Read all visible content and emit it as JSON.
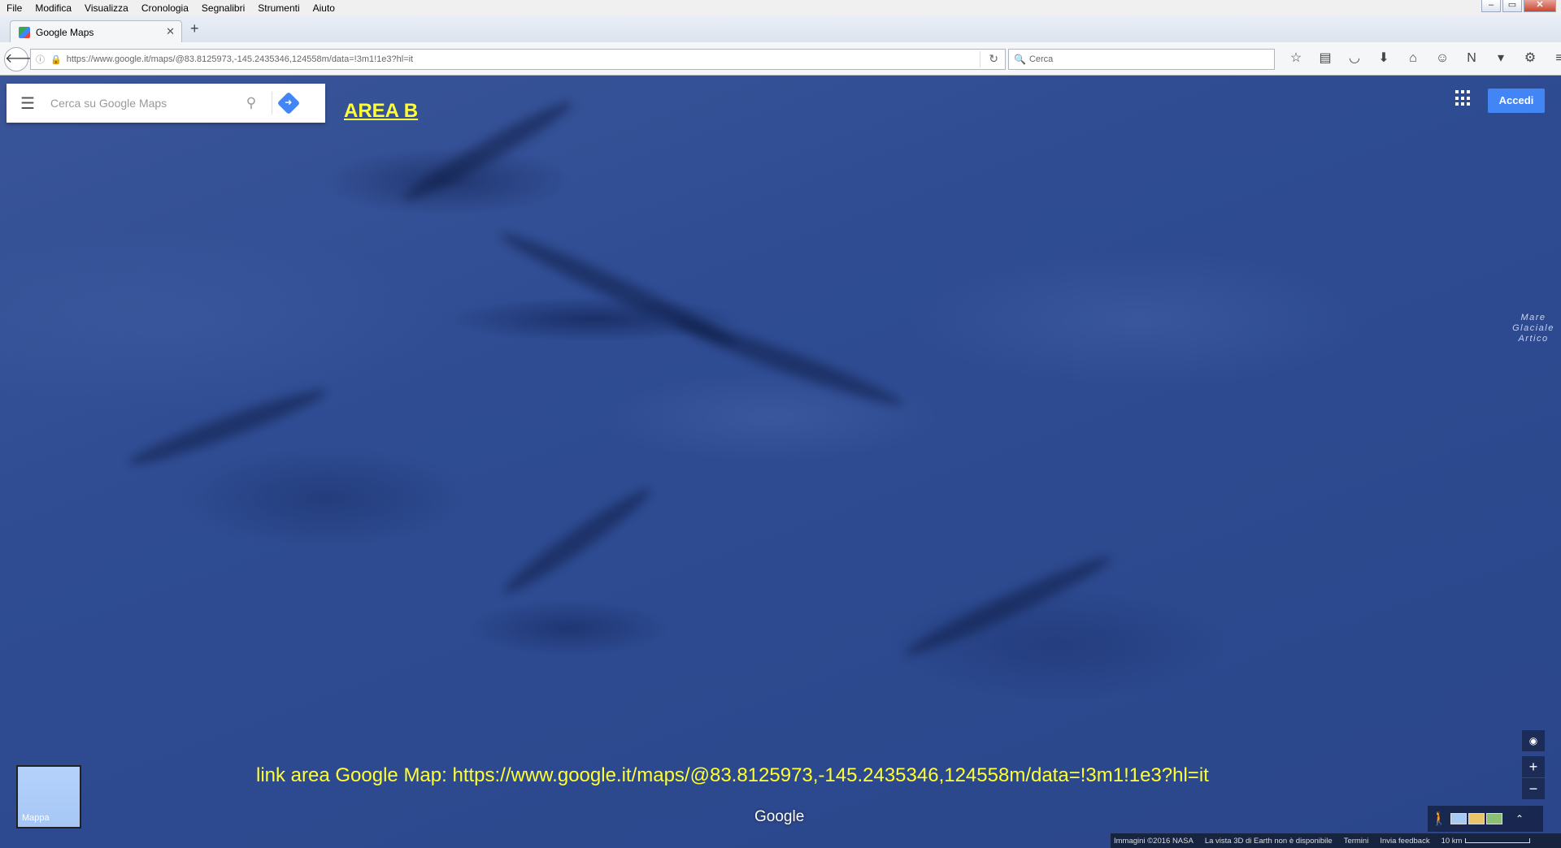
{
  "browser": {
    "menu": [
      "File",
      "Modifica",
      "Visualizza",
      "Cronologia",
      "Segnalibri",
      "Strumenti",
      "Aiuto"
    ],
    "window_controls": {
      "minimize": "–",
      "maximize": "▭",
      "close": "✕"
    },
    "tab": {
      "title": "Google Maps",
      "close_glyph": "✕"
    },
    "new_tab_glyph": "+",
    "url": "https://www.google.it/maps/@83.8125973,-145.2435346,124558m/data=!3m1!1e3?hl=it",
    "search_placeholder": "Cerca",
    "toolbar_icons": [
      "star-icon",
      "reading-list-icon",
      "pocket-icon",
      "download-icon",
      "home-icon",
      "chat-icon",
      "onenote-icon",
      "dropdown-icon",
      "extension-icon",
      "menu-icon"
    ]
  },
  "map": {
    "search_placeholder": "Cerca su Google Maps",
    "annotation_title": "AREA B",
    "sign_in_label": "Accedi",
    "sea_label": "Mare Glaciale Artico",
    "link_caption": "link area Google Map:  https://www.google.it/maps/@83.8125973,-145.2435346,124558m/data=!3m1!1e3?hl=it",
    "brand": "Google",
    "layer_label": "Mappa",
    "zoom_in": "+",
    "zoom_out": "−",
    "footer": {
      "imagery": "Immagini ©2016 NASA",
      "notice": "La vista 3D di Earth non è disponibile",
      "terms": "Termini",
      "feedback": "Invia feedback",
      "scale": "10 km"
    },
    "colors": {
      "accent": "#4285f4",
      "annotation": "#ffff33"
    }
  }
}
